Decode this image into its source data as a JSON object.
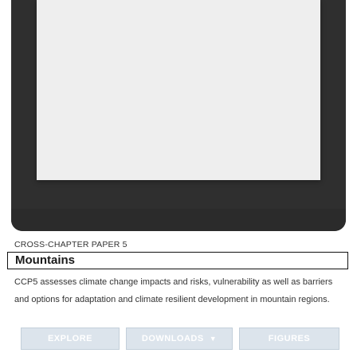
{
  "hero": {
    "image_name": "laptop-image"
  },
  "section": {
    "kicker": "CROSS-CHAPTER PAPER 5",
    "title": "Mountains",
    "description": "CCP5 assesses climate change impacts and risks, vulnerability as well as barriers and options for adaptation and climate resilient development in mountain regions."
  },
  "buttons": {
    "explore_label": "EXPLORE",
    "downloads_label": "DOWNLOADS",
    "downloads_icon": "chevron-down-icon",
    "figures_label": "FIGURES"
  },
  "colors": {
    "button_bg": "#dce4ec",
    "button_text": "#ffffff",
    "title_border": "#111111"
  }
}
